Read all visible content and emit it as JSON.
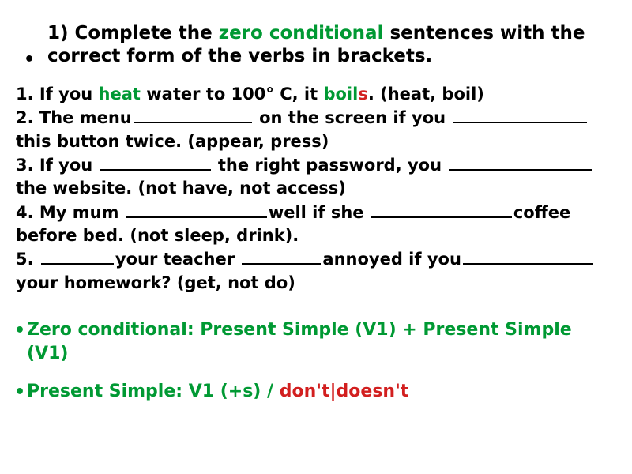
{
  "title": {
    "pre": "1) Complete the ",
    "kw": "zero conditional",
    "post": " sentences with the correct form of the verbs in brackets."
  },
  "q1": {
    "a": "1. If you ",
    "heat": "heat",
    "b": " water to 100° C, it ",
    "boil": "boil",
    "s": "s",
    "c": ". (heat, boil)"
  },
  "q2": {
    "a": "2. The menu",
    "b": " on the screen if you ",
    "c": " this button twice. (appear, press)"
  },
  "q3": {
    "a": "3. If you ",
    "b": " the right password, you ",
    "c": "the website. (not have, not access)"
  },
  "q4": {
    "a": "4. My mum ",
    "b": "well if she ",
    "c": "coffee before bed. (not sleep, drink)."
  },
  "q5": {
    "a": "5. ",
    "b": "your teacher ",
    "c": "annoyed if you",
    "d": " your homework? (get, not do)"
  },
  "hint1": {
    "text": "Zero conditional: Present Simple (V1) + Present Simple (V1)"
  },
  "hint2": {
    "a": "Present Simple: V1 (+s) / ",
    "b": "don't|doesn't"
  },
  "bullet": "•"
}
